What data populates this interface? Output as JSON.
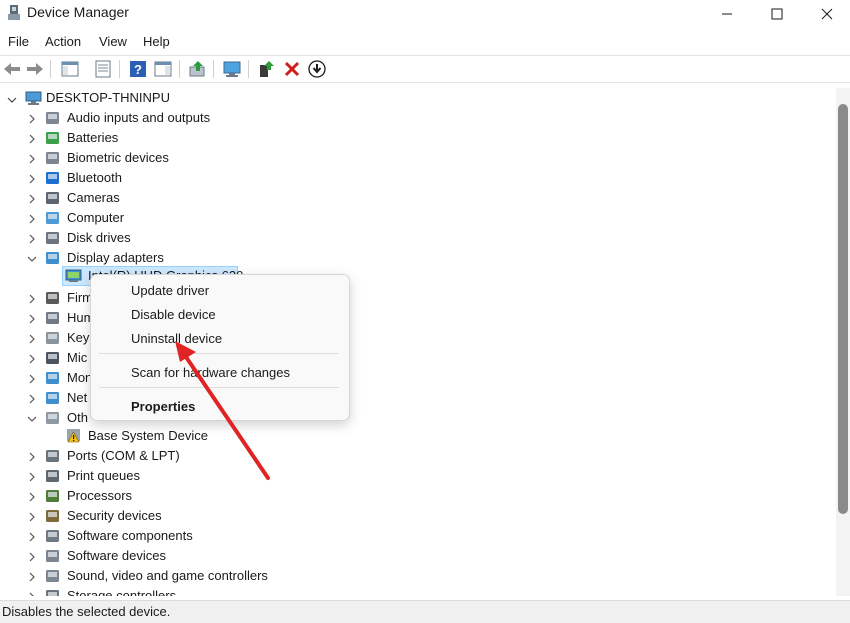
{
  "window": {
    "title": "Device Manager",
    "controls": [
      "minimize",
      "maximize",
      "close"
    ]
  },
  "menu": {
    "items": [
      "File",
      "Action",
      "View",
      "Help"
    ]
  },
  "toolbar": {
    "buttons": [
      "back-icon",
      "forward-icon",
      "show-hide-console-tree-icon",
      "properties-icon",
      "help-icon",
      "action-pane-icon",
      "update-driver-icon",
      "scan-hardware-icon",
      "enable-device-icon",
      "uninstall-icon",
      "disable-device-icon"
    ]
  },
  "tree": {
    "root": "DESKTOP-THNINPU",
    "categories": [
      {
        "label": "Audio inputs and outputs",
        "icon": "speaker-icon",
        "expanded": false
      },
      {
        "label": "Batteries",
        "icon": "battery-icon",
        "expanded": false
      },
      {
        "label": "Biometric devices",
        "icon": "fingerprint-icon",
        "expanded": false
      },
      {
        "label": "Bluetooth",
        "icon": "bluetooth-icon",
        "expanded": false
      },
      {
        "label": "Cameras",
        "icon": "camera-icon",
        "expanded": false
      },
      {
        "label": "Computer",
        "icon": "computer-icon",
        "expanded": false
      },
      {
        "label": "Disk drives",
        "icon": "disk-drive-icon",
        "expanded": false
      },
      {
        "label": "Display adapters",
        "icon": "display-adapter-icon",
        "expanded": true
      },
      {
        "label": "Firm",
        "icon": "firmware-icon",
        "expanded": false
      },
      {
        "label": "Hum",
        "icon": "hid-icon",
        "expanded": false
      },
      {
        "label": "Key",
        "icon": "keyboard-icon",
        "expanded": false
      },
      {
        "label": "Mic",
        "icon": "mouse-icon",
        "expanded": false
      },
      {
        "label": "Mon",
        "icon": "monitor-icon",
        "expanded": false
      },
      {
        "label": "Net",
        "icon": "network-icon",
        "expanded": false
      },
      {
        "label": "Oth",
        "icon": "other-devices-icon",
        "expanded": true
      },
      {
        "label": "Ports (COM & LPT)",
        "icon": "port-icon",
        "expanded": false
      },
      {
        "label": "Print queues",
        "icon": "printer-icon",
        "expanded": false
      },
      {
        "label": "Processors",
        "icon": "processor-icon",
        "expanded": false
      },
      {
        "label": "Security devices",
        "icon": "security-icon",
        "expanded": false
      },
      {
        "label": "Software components",
        "icon": "software-component-icon",
        "expanded": false
      },
      {
        "label": "Software devices",
        "icon": "software-device-icon",
        "expanded": false
      },
      {
        "label": "Sound, video and game controllers",
        "icon": "sound-icon",
        "expanded": false
      },
      {
        "label": "Storage controllers",
        "icon": "storage-icon",
        "expanded": false
      }
    ],
    "display_child": "Intel(R) UHD Graphics 620",
    "other_child": "Base System Device"
  },
  "context_menu": {
    "items": [
      "Update driver",
      "Disable device",
      "Uninstall device",
      "Scan for hardware changes",
      "Properties"
    ]
  },
  "status": {
    "text": "Disables the selected device."
  },
  "colors": {
    "selection": "#cce8ff",
    "arrow": "#e02424",
    "scrollbar_thumb": "#8a8a8a"
  }
}
